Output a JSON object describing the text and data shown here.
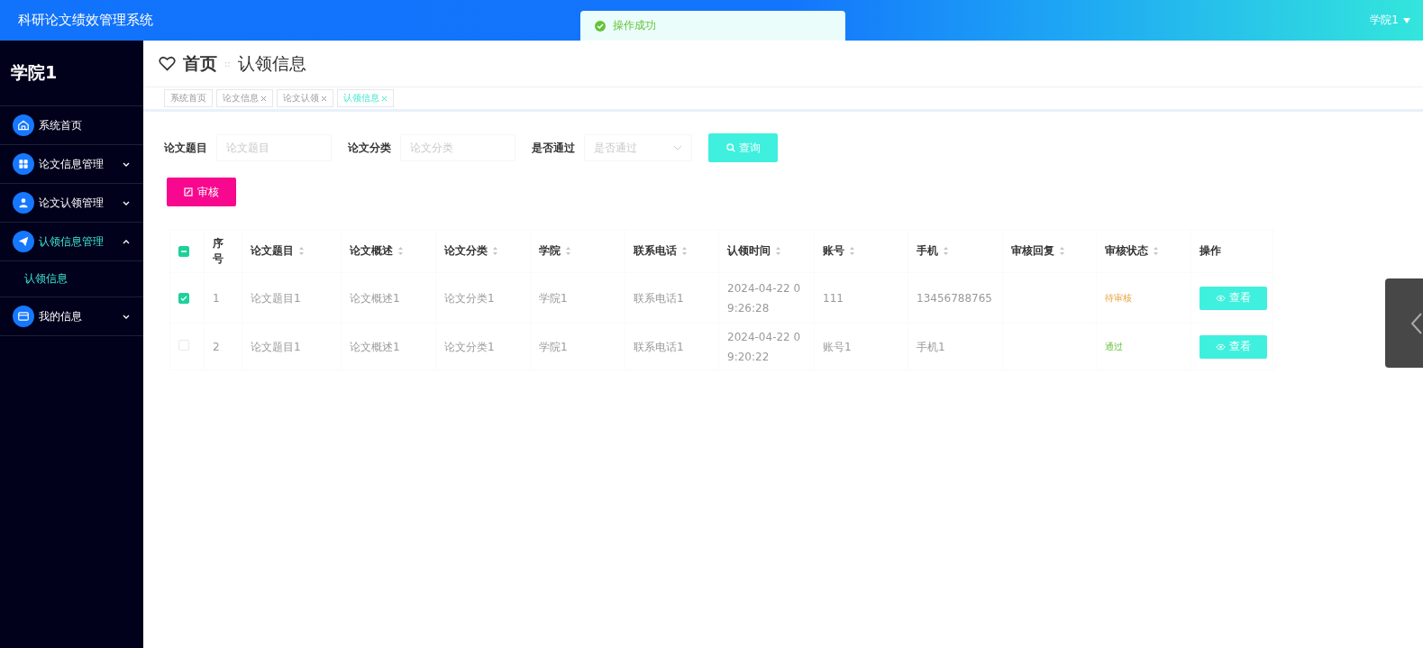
{
  "header": {
    "title": "科研论文绩效管理系统",
    "user": "学院1"
  },
  "toast": {
    "message": "操作成功"
  },
  "sidebar": {
    "title": "学院1",
    "items": [
      {
        "label": "系统首页",
        "expandable": false,
        "expanded": false
      },
      {
        "label": "论文信息管理",
        "expandable": true,
        "expanded": false
      },
      {
        "label": "论文认领管理",
        "expandable": true,
        "expanded": false
      },
      {
        "label": "认领信息管理",
        "expandable": true,
        "expanded": true,
        "children": [
          {
            "label": "认领信息",
            "selected": true
          }
        ]
      },
      {
        "label": "我的信息",
        "expandable": true,
        "expanded": false
      }
    ]
  },
  "breadcrumb": {
    "home": "首页",
    "separator": "::",
    "current": "认领信息"
  },
  "tabs": [
    {
      "label": "系统首页",
      "closable": false,
      "selected": false
    },
    {
      "label": "论文信息",
      "closable": true,
      "selected": false
    },
    {
      "label": "论文认领",
      "closable": true,
      "selected": false
    },
    {
      "label": "认领信息",
      "closable": true,
      "selected": true
    }
  ],
  "filters": [
    {
      "label": "论文题目",
      "kind": "text",
      "placeholder": "论文题目"
    },
    {
      "label": "论文分类",
      "kind": "text",
      "placeholder": "论文分类"
    },
    {
      "label": "是否通过",
      "kind": "select",
      "placeholder": "是否通过"
    }
  ],
  "search_button": "查询",
  "review_button": "审核",
  "table": {
    "select_all": {
      "indeterminate": true
    },
    "columns": [
      {
        "label": "序号",
        "sortable": false
      },
      {
        "label": "论文题目",
        "sortable": true
      },
      {
        "label": "论文概述",
        "sortable": true
      },
      {
        "label": "论文分类",
        "sortable": true
      },
      {
        "label": "学院",
        "sortable": true
      },
      {
        "label": "联系电话",
        "sortable": true
      },
      {
        "label": "认领时间",
        "sortable": true
      },
      {
        "label": "账号",
        "sortable": true
      },
      {
        "label": "手机",
        "sortable": true
      },
      {
        "label": "审核回复",
        "sortable": true
      },
      {
        "label": "审核状态",
        "sortable": true
      },
      {
        "label": "操作",
        "sortable": false
      }
    ],
    "rows": [
      {
        "checked": true,
        "cells": [
          "1",
          "论文题目1",
          "论文概述1",
          "论文分类1",
          "学院1",
          "联系电话1",
          "2024-04-22 09:26:28",
          "111",
          "13456788765",
          ""
        ],
        "status": {
          "label": "待审核",
          "kind": "pending"
        },
        "action": "查看"
      },
      {
        "checked": false,
        "cells": [
          "2",
          "论文题目1",
          "论文概述1",
          "论文分类1",
          "学院1",
          "联系电话1",
          "2024-04-22 09:20:22",
          "账号1",
          "手机1",
          ""
        ],
        "status": {
          "label": "通过",
          "kind": "passed"
        },
        "action": "查看"
      }
    ]
  }
}
